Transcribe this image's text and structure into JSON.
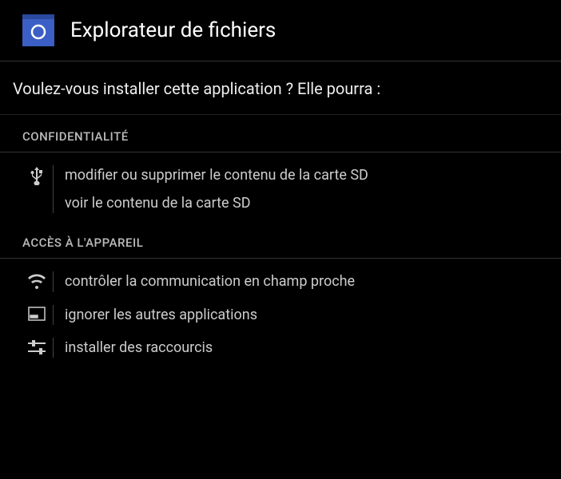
{
  "header": {
    "app_title": "Explorateur de fichiers"
  },
  "prompt": "Voulez-vous installer cette application ? Elle pourra :",
  "sections": {
    "privacy": {
      "title": "CONFIDENTIALITÉ",
      "items": {
        "usb": {
          "line1": "modifier ou supprimer le contenu de la carte SD",
          "line2": "voir le contenu de la carte SD"
        }
      }
    },
    "device": {
      "title": "ACCÈS À L'APPAREIL",
      "items": {
        "wifi": "contrôler la communication en champ proche",
        "apps": "ignorer les autres applications",
        "shortcuts": "installer des raccourcis"
      }
    }
  }
}
